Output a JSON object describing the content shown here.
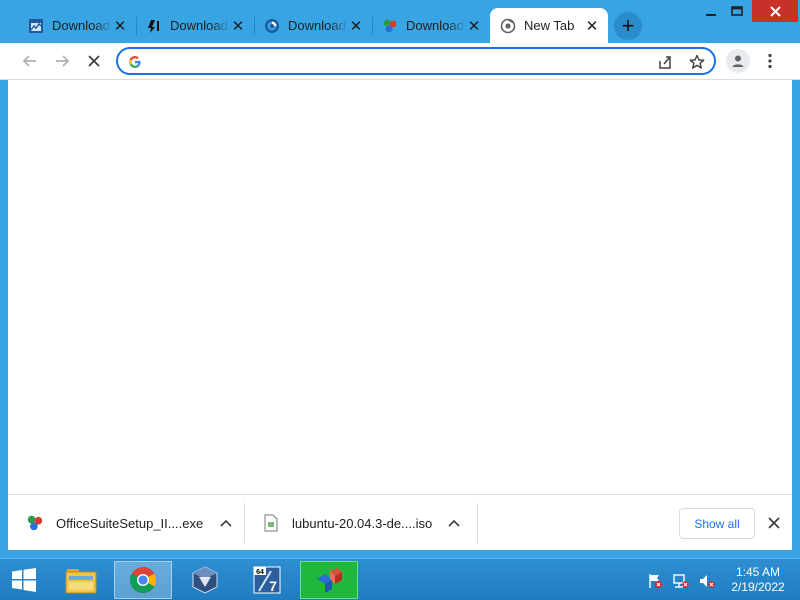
{
  "tabs": [
    {
      "label": "Download",
      "icon": "chart-window-icon",
      "active": false
    },
    {
      "label": "Download",
      "icon": "torrent-arrows-icon",
      "active": false
    },
    {
      "label": "Download",
      "icon": "circular-logo-icon",
      "active": false
    },
    {
      "label": "Download",
      "icon": "officesuite-icon",
      "active": false
    },
    {
      "label": "New Tab",
      "icon": "chrome-newtab-icon",
      "active": true
    }
  ],
  "tab_close_glyph": "✕",
  "new_tab_glyph": "+",
  "window_controls": {
    "minimize": "—",
    "maximize": "☐",
    "close": "✕"
  },
  "toolbar": {
    "back_icon": "back-arrow-icon",
    "forward_icon": "forward-arrow-icon",
    "stop_icon": "stop-loading-icon",
    "omnibox": {
      "value": "",
      "placeholder": "",
      "provider_icon": "google-g-icon"
    },
    "share_icon": "share-icon",
    "bookmark_icon": "star-icon",
    "profile_icon": "profile-avatar-icon",
    "menu_icon": "three-dot-menu-icon"
  },
  "downloads": [
    {
      "name": "OfficeSuiteSetup_II....exe",
      "icon": "officesuite-icon"
    },
    {
      "name": "lubuntu-20.04.3-de....iso",
      "icon": "file-icon"
    }
  ],
  "show_all_label": "Show all",
  "taskbar": {
    "start_icon": "windows-logo-icon",
    "apps": [
      {
        "name": "File Explorer",
        "icon": "folder-icon",
        "state": "normal"
      },
      {
        "name": "Google Chrome",
        "icon": "chrome-icon",
        "state": "active"
      },
      {
        "name": "VirtualBox",
        "icon": "virtualbox-icon",
        "state": "normal"
      },
      {
        "name": "64-bit app",
        "icon": "app-64-7-icon",
        "state": "normal",
        "badge": "64",
        "badge_number": "7"
      },
      {
        "name": "OfficeSuite",
        "icon": "officesuite-icon",
        "state": "highlight"
      }
    ],
    "tray_icons": [
      "flag-alert-icon",
      "network-alert-icon",
      "speaker-muted-icon"
    ],
    "clock": {
      "time": "1:45 AM",
      "date": "2/19/2022"
    }
  },
  "colors": {
    "titlebar": "#38a4e3",
    "accent": "#1a73e8",
    "close_red": "#c7312a",
    "taskbar": "#1f7cc0",
    "taskbar_highlight": "#1fb83c"
  }
}
